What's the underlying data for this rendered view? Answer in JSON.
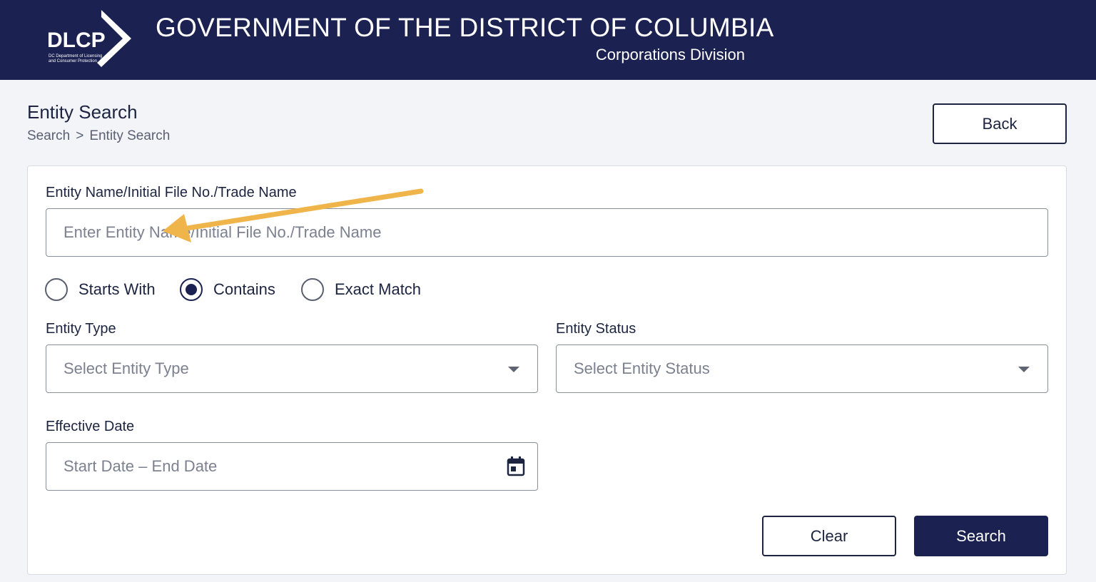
{
  "header": {
    "logo_text": "DLCP",
    "logo_subtext_line1": "DC Department of Licensing",
    "logo_subtext_line2": "and Consumer Protection",
    "title": "GOVERNMENT OF THE DISTRICT OF COLUMBIA",
    "subtitle": "Corporations Division",
    "background_color": "#1b2150"
  },
  "page": {
    "title": "Entity Search",
    "breadcrumb": [
      "Search",
      "Entity Search"
    ],
    "breadcrumb_separator": ">",
    "back_label": "Back"
  },
  "form": {
    "entity_name": {
      "label": "Entity Name/Initial File No./Trade Name",
      "placeholder": "Enter Entity Name/Initial File No./Trade Name",
      "value": ""
    },
    "match_options": [
      {
        "label": "Starts With",
        "selected": false
      },
      {
        "label": "Contains",
        "selected": true
      },
      {
        "label": "Exact Match",
        "selected": false
      }
    ],
    "entity_type": {
      "label": "Entity Type",
      "placeholder": "Select Entity Type"
    },
    "entity_status": {
      "label": "Entity Status",
      "placeholder": "Select Entity Status"
    },
    "effective_date": {
      "label": "Effective Date",
      "start_placeholder": "Start Date",
      "range_separator": "–",
      "end_placeholder": "End Date",
      "icon": "calendar-icon"
    },
    "clear_label": "Clear",
    "search_label": "Search"
  },
  "annotation": {
    "icon": "arrow-annotation",
    "color": "#f0b54a"
  }
}
